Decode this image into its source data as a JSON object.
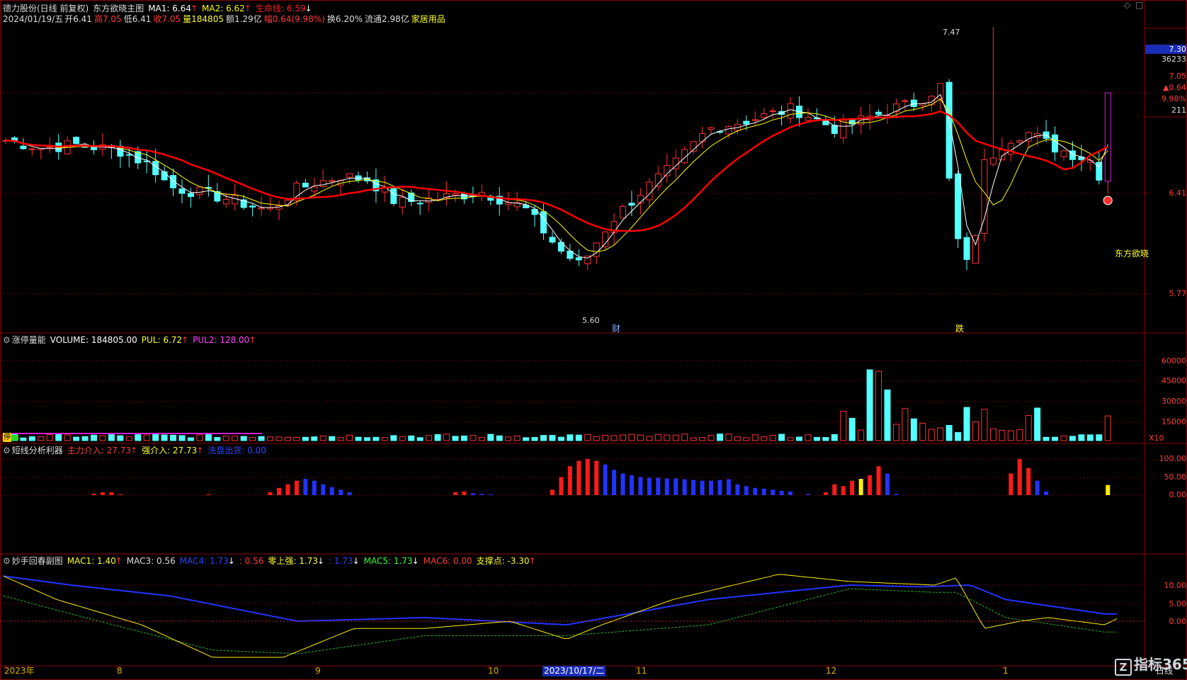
{
  "header": {
    "stock": "德力股份(日线 前复权)",
    "indicator": "东方欲晓主图",
    "ma1": "MA1: 6.64",
    "ma2": "MA2: 6.62",
    "lifeline": "生命线: 6.59",
    "date": "2024/01/19/五",
    "open": "开6.41",
    "high": "高7.05",
    "low": "低6.41",
    "close": "收7.05",
    "vol": "量184805",
    "amount": "额1.29亿",
    "change": "幅0.64(9.98%)",
    "turnover": "换6.20%",
    "float": "流通2.98亿",
    "sector": "家居用品"
  },
  "main_axis": {
    "current": "7.30",
    "volume": "36233",
    "price": "7.05",
    "change": "▲0.64",
    "pct": "9.98%",
    "count": "211",
    "ticks": [
      "6.41",
      "5.77"
    ]
  },
  "annotations": {
    "high": "7.47",
    "low": "5.60",
    "tag1": "财",
    "tag2": "跌",
    "side": "东方欲晓"
  },
  "vol_panel": {
    "title": "涨停量能",
    "volume": "VOLUME: 184805.00",
    "pul": "PUL: 6.72",
    "pul2": "PUL2: 128.00",
    "ticks": [
      "60000",
      "45000",
      "30000",
      "15000"
    ],
    "unit": "X10",
    "badge": "停"
  },
  "short_panel": {
    "title": "短线分析利器",
    "main": "主力介入: 27.73",
    "strong": "强介入: 27.73",
    "wash": "洗盘出货: 0.00",
    "ticks": [
      "100.00",
      "50.00",
      "0.00"
    ]
  },
  "mac_panel": {
    "title": "妙手回春副图",
    "mac1": "MAC1: 1.40",
    "mac3": "MAC3: 0.56",
    "mac4": "MAC4: 1.73",
    "v056": ": 0.56",
    "zero_strong": "零上强: 1.73",
    "v173": ": 1.73",
    "mac5": "MAC5: 1.73",
    "mac6": "MAC6: 0.00",
    "support": "支撑点: -3.30",
    "ticks": [
      "10.00",
      "5.00",
      "0.00"
    ]
  },
  "x_axis": {
    "labels": [
      "2023年",
      "8",
      "9",
      "10",
      "2023/10/17/二",
      "11",
      "12",
      "1"
    ],
    "period": "日线"
  },
  "toolbar": {
    "diamond": "◇",
    "window": "□"
  },
  "watermark": {
    "mark": "Z",
    "text": "指标365"
  },
  "colors": {
    "up": "#ff3232",
    "down": "#54ffff",
    "ma1": "#ffffff",
    "ma2": "#ffff00",
    "life": "#ff0000",
    "grid": "#6e0000"
  }
}
